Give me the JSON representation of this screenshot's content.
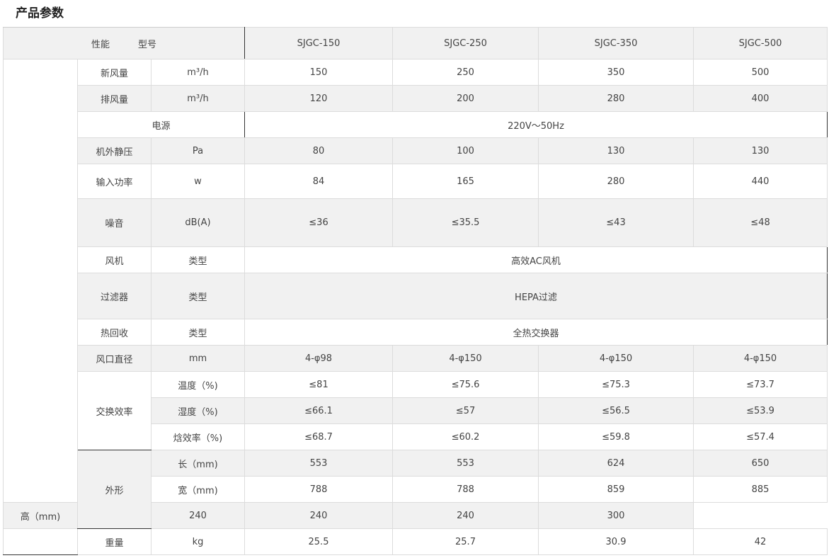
{
  "title": "产品参数",
  "header": {
    "label1": "性能",
    "label2": "型号",
    "models": [
      "SJGC-150",
      "SJGC-250",
      "SJGC-350",
      "SJGC-500"
    ]
  },
  "rows": {
    "fresh_air": {
      "name": "新风量",
      "unit": "m³/h",
      "values": [
        "150",
        "250",
        "350",
        "500"
      ]
    },
    "exhaust": {
      "name": "排风量",
      "unit": "m³/h",
      "values": [
        "120",
        "200",
        "280",
        "400"
      ]
    },
    "power_supply": {
      "name": "电源",
      "value": "220V～50Hz"
    },
    "static_pressure": {
      "name": "机外静压",
      "unit": "Pa",
      "values": [
        "80",
        "100",
        "130",
        "130"
      ]
    },
    "input_power": {
      "name": "输入功率",
      "unit": "w",
      "values": [
        "84",
        "165",
        "280",
        "440"
      ]
    },
    "noise": {
      "name": "噪音",
      "unit": "dB(A)",
      "values": [
        "≤36",
        "≤35.5",
        "≤43",
        "≤48"
      ]
    },
    "fan": {
      "name": "风机",
      "unit": "类型",
      "value": "高效AC风机"
    },
    "filter": {
      "name": "过滤器",
      "unit": "类型",
      "value": "HEPA过滤"
    },
    "heat_recovery": {
      "name": "热回收",
      "unit": "类型",
      "value": "全热交换器"
    },
    "duct_diameter": {
      "name": "风口直径",
      "unit": "mm",
      "values": [
        "4-φ98",
        "4-φ150",
        "4-φ150",
        "4-φ150"
      ]
    },
    "efficiency": {
      "name": "交换效率",
      "sub": [
        {
          "unit": "温度（%)",
          "values": [
            "≤81",
            "≤75.6",
            "≤75.3",
            "≤73.7"
          ]
        },
        {
          "unit": "湿度（%)",
          "values": [
            "≤66.1",
            "≤57",
            "≤56.5",
            "≤53.9"
          ]
        },
        {
          "unit": "焓效率（%)",
          "values": [
            "≤68.7",
            "≤60.2",
            "≤59.8",
            "≤57.4"
          ]
        }
      ]
    },
    "dimensions": {
      "name": "外形",
      "sub": [
        {
          "unit": "长（mm)",
          "values": [
            "553",
            "553",
            "624",
            "650"
          ]
        },
        {
          "unit": "宽（mm)",
          "values": [
            "788",
            "788",
            "859",
            "885"
          ]
        },
        {
          "unit": "高（mm)",
          "values": [
            "240",
            "240",
            "240",
            "300"
          ]
        }
      ]
    },
    "weight": {
      "name": "重量",
      "unit": "kg",
      "values": [
        "25.5",
        "25.7",
        "30.9",
        "42"
      ]
    }
  }
}
